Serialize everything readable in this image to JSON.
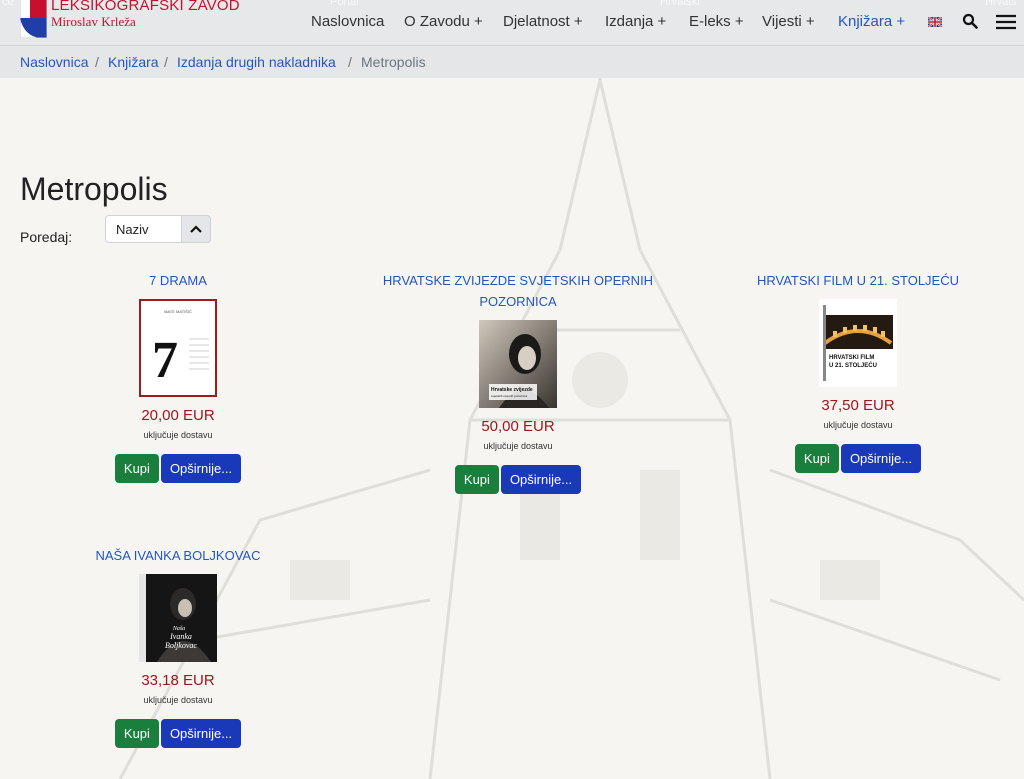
{
  "header": {
    "logo_line1": "LEKSIKOGRAFSKI ZAVOD",
    "logo_line2": "Miroslav Krleža",
    "nav": [
      {
        "label": "Naslovnica"
      },
      {
        "label": "O Zavodu +"
      },
      {
        "label": "Djelatnost +"
      },
      {
        "label": "Izdanja +"
      },
      {
        "label": "E-leks +"
      },
      {
        "label": "Vijesti +"
      },
      {
        "label": "Knjižara +"
      }
    ],
    "icons": {
      "flag": "uk-flag-icon",
      "search": "search-icon",
      "menu": "hamburger-menu-icon"
    },
    "accent_color": "#2456c2"
  },
  "breadcrumb": {
    "items": [
      "Naslovnica",
      "Knjižara",
      "Izdanja drugih nakladnika"
    ],
    "current": "Metropolis",
    "separator": "/"
  },
  "main": {
    "title": "Metropolis",
    "sort_label": "Poredaj:",
    "sort_value": "Naziv",
    "products": [
      {
        "title": "7 DRAMA",
        "price": "20,00 EUR",
        "note": "uključuje dostavu",
        "buy": "Kupi",
        "more": "Opširnije..."
      },
      {
        "title": "HRVATSKE ZVIJEZDE SVJETSKIH OPERNIH POZORNICA",
        "price": "50,00 EUR",
        "note": "uključuje dostavu",
        "buy": "Kupi",
        "more": "Opširnije..."
      },
      {
        "title": "HRVATSKI FILM U 21. STOLJEĆU",
        "price": "37,50 EUR",
        "note": "uključuje dostavu",
        "buy": "Kupi",
        "more": "Opširnije..."
      },
      {
        "title": "NAŠA IVANKA BOLJKOVAC",
        "price": "33,18 EUR",
        "note": "uključuje dostavu",
        "buy": "Kupi",
        "more": "Opširnije..."
      }
    ]
  },
  "covers": {
    "drama_author": "MATE MATIŠIĆ",
    "drama_number": "7",
    "opera_cover_text": "Hrvatske zvijezde svjetskih opernih pozornica",
    "film_cover_text": "HRVATSKI FILM U 21. STOLJEĆU",
    "ivanka_cover_text": "Naša Ivanka Boljkovac"
  },
  "colors": {
    "price": "#a3151c",
    "buy_button": "#1a7f3c",
    "more_button": "#1a39b9",
    "link": "#2456c2"
  }
}
